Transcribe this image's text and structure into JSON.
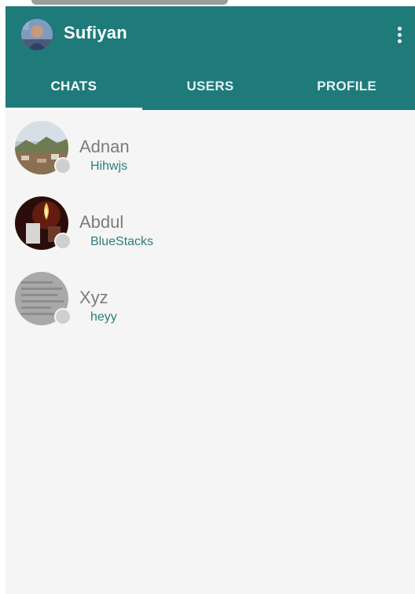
{
  "toolbar": {
    "title": "Sufiyan",
    "profile_avatar_icon": "user-photo-icon",
    "menu_icon": "more-vert-icon"
  },
  "tabs": [
    {
      "label": "CHATS",
      "active": true
    },
    {
      "label": "USERS",
      "active": false
    },
    {
      "label": "PROFILE",
      "active": false
    }
  ],
  "chats": [
    {
      "name": "Adnan",
      "last_message": "Hihwjs",
      "avatar_icon": "landscape-photo-icon"
    },
    {
      "name": "Abdul",
      "last_message": "BlueStacks",
      "avatar_icon": "candle-photo-icon"
    },
    {
      "name": "Xyz",
      "last_message": "heyy",
      "avatar_icon": "document-photo-icon"
    }
  ],
  "colors": {
    "primary": "#1f7a7a",
    "background": "#f5f5f5",
    "name_text": "#7b7b7b",
    "message_text": "#2e7d7d",
    "status_dot": "#cfcfcf"
  }
}
